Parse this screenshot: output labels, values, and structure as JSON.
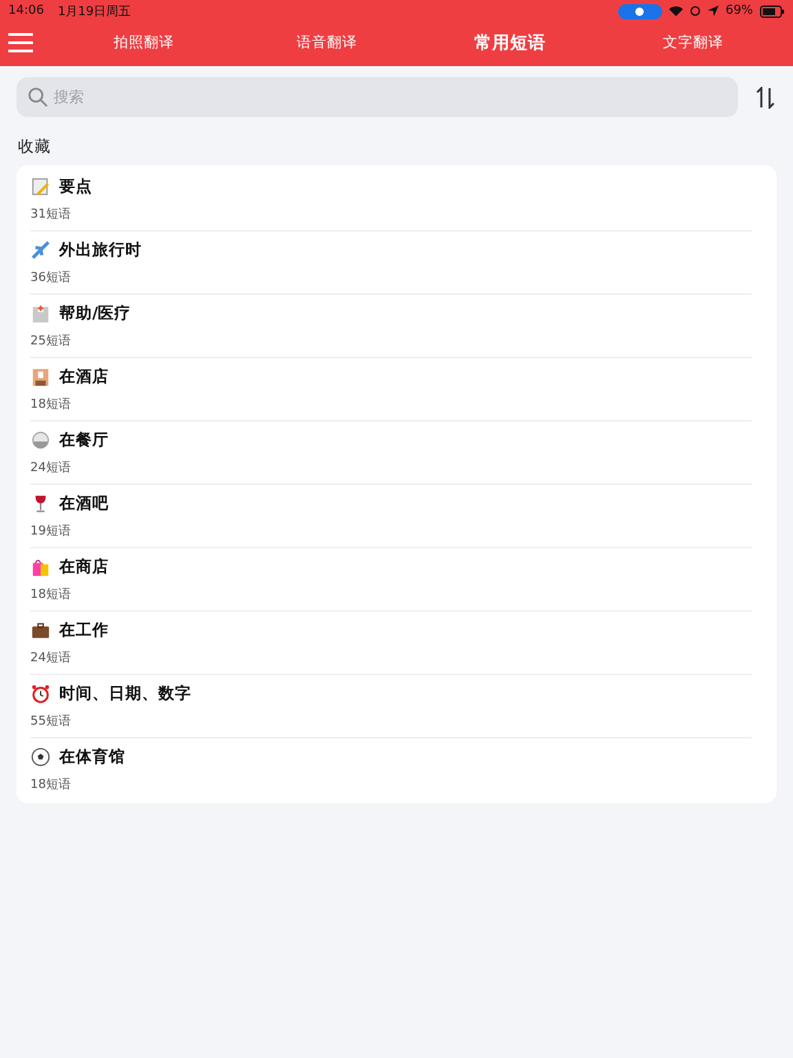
{
  "status_bar": {
    "time": "14:06",
    "date": "1月19日周五",
    "battery": "69%"
  },
  "tabs": [
    {
      "label": "拍照翻译",
      "selected": false
    },
    {
      "label": "语音翻译",
      "selected": false
    },
    {
      "label": "常用短语",
      "selected": true
    },
    {
      "label": "文字翻译",
      "selected": false
    }
  ],
  "search": {
    "placeholder": "搜索"
  },
  "section_title": "收藏",
  "categories": [
    {
      "title": "要点",
      "count": "31短语"
    },
    {
      "title": "外出旅行时",
      "count": "36短语"
    },
    {
      "title": "帮助/医疗",
      "count": "25短语"
    },
    {
      "title": "在酒店",
      "count": "18短语"
    },
    {
      "title": "在餐厅",
      "count": "24短语"
    },
    {
      "title": "在酒吧",
      "count": "19短语"
    },
    {
      "title": "在商店",
      "count": "18短语"
    },
    {
      "title": "在工作",
      "count": "24短语"
    },
    {
      "title": "时间、日期、数字",
      "count": "55短语"
    },
    {
      "title": "在体育馆",
      "count": "18短语"
    }
  ]
}
